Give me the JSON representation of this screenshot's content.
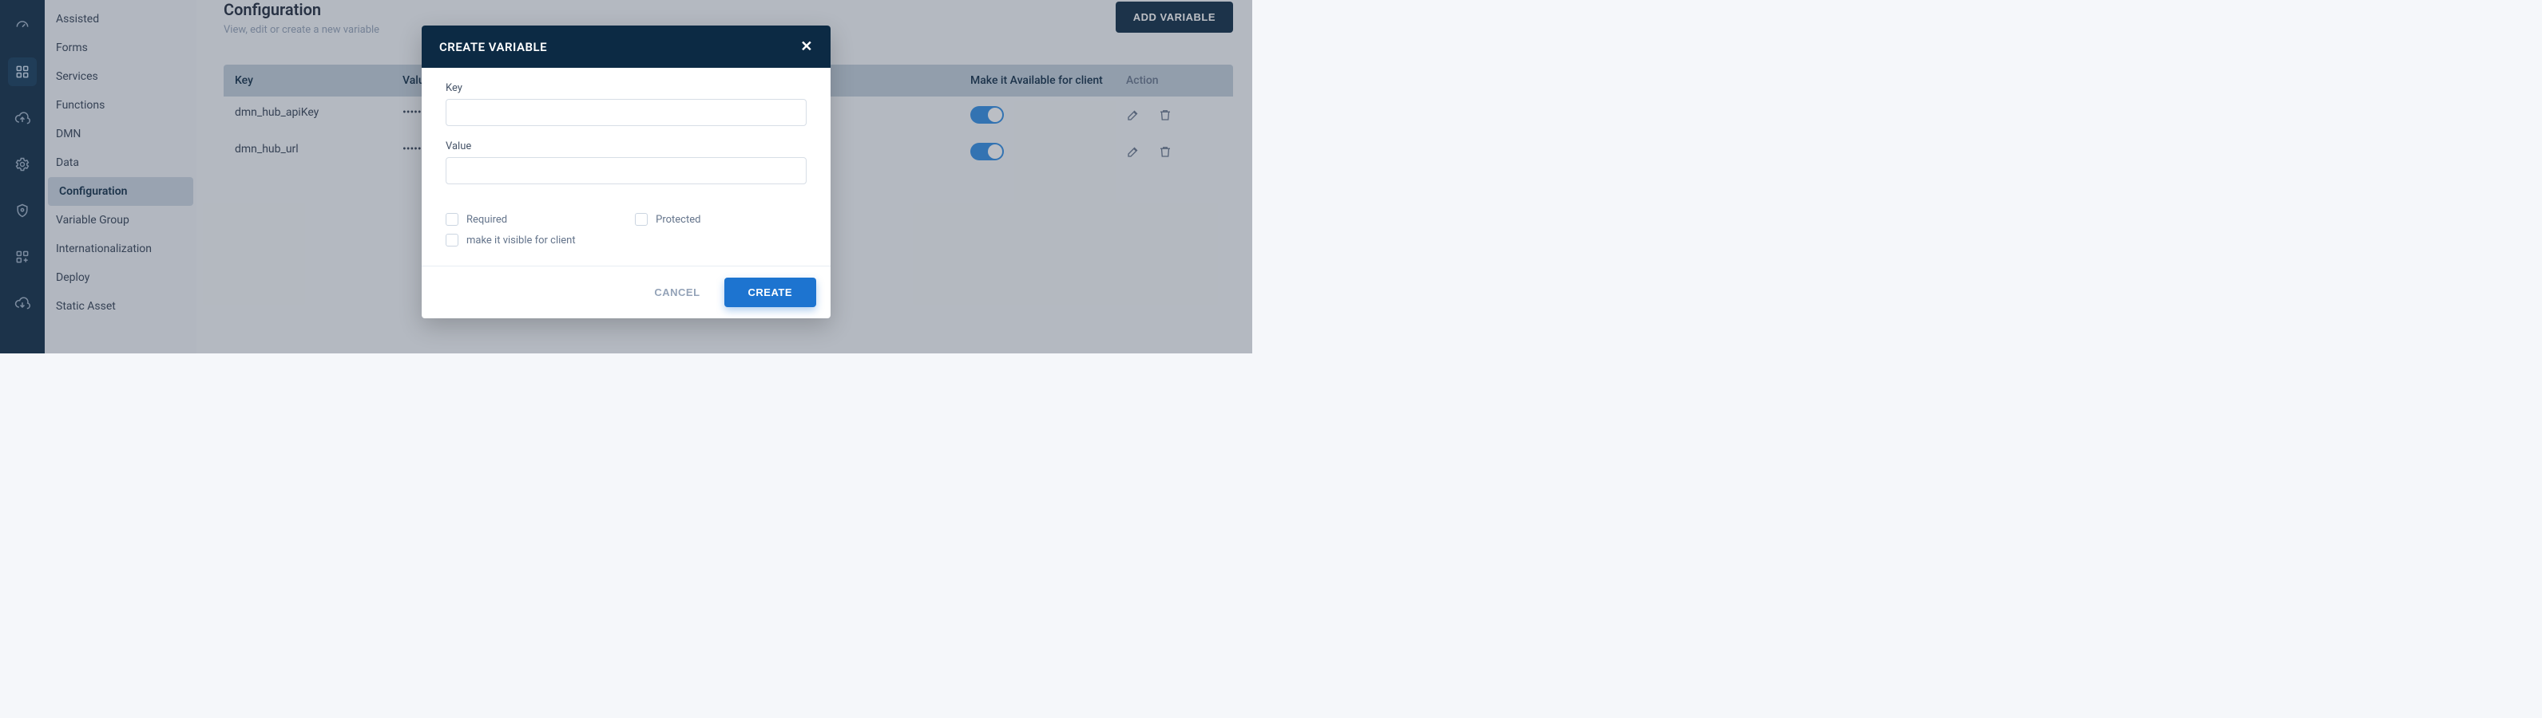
{
  "sidebar": {
    "items": [
      {
        "label": "Assisted"
      },
      {
        "label": "Forms"
      },
      {
        "label": "Services"
      },
      {
        "label": "Functions"
      },
      {
        "label": "DMN"
      },
      {
        "label": "Data"
      },
      {
        "label": "Configuration"
      },
      {
        "label": "Variable Group"
      },
      {
        "label": "Internationalization"
      },
      {
        "label": "Deploy"
      },
      {
        "label": "Static Asset"
      }
    ]
  },
  "page": {
    "title": "Configuration",
    "subtitle": "View, edit or create a new variable",
    "add_button": "ADD VARIABLE"
  },
  "table": {
    "headers": {
      "key": "Key",
      "value": "Value",
      "avail": "Make it Available for client",
      "action": "Action"
    },
    "rows": [
      {
        "key": "dmn_hub_apiKey",
        "value": "••••••",
        "avail": true
      },
      {
        "key": "dmn_hub_url",
        "value": "••••••",
        "avail": true
      }
    ]
  },
  "modal": {
    "title": "CREATE VARIABLE",
    "key_label": "Key",
    "key_value": "",
    "value_label": "Value",
    "value_value": "",
    "required_label": "Required",
    "protected_label": "Protected",
    "visible_label": "make it visible for client",
    "cancel": "CANCEL",
    "create": "CREATE"
  }
}
